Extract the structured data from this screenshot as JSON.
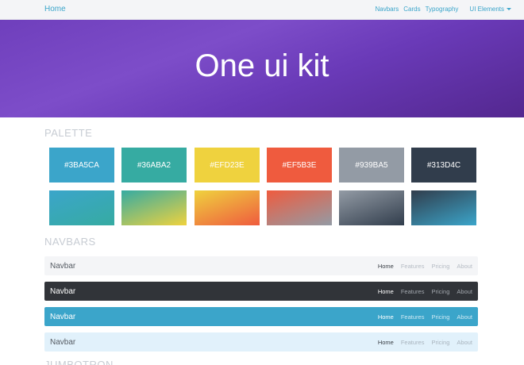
{
  "topnav": {
    "brand": "Home",
    "links": [
      "Navbars",
      "Cards",
      "Typography"
    ],
    "dropdown": "UI Elements"
  },
  "hero": {
    "title": "One ui kit"
  },
  "palette": {
    "heading": "PALETTE",
    "solid": [
      {
        "label": "#3BA5CA",
        "color": "#3BA5CA"
      },
      {
        "label": "#36ABA2",
        "color": "#36ABA2"
      },
      {
        "label": "#EFD23E",
        "color": "#EFD23E"
      },
      {
        "label": "#EF5B3E",
        "color": "#EF5B3E"
      },
      {
        "label": "#939BA5",
        "color": "#939BA5"
      },
      {
        "label": "#313D4C",
        "color": "#313D4C"
      }
    ],
    "gradients": [
      {
        "from": "#3BA5CA",
        "to": "#36ABA2"
      },
      {
        "from": "#36ABA2",
        "to": "#EFD23E"
      },
      {
        "from": "#EFD23E",
        "to": "#EF5B3E"
      },
      {
        "from": "#EF5B3E",
        "to": "#939BA5"
      },
      {
        "from": "#939BA5",
        "to": "#313D4C"
      },
      {
        "from": "#313D4C",
        "to": "#3BA5CA"
      }
    ]
  },
  "navbars": {
    "heading": "NAVBARS",
    "items": [
      {
        "brand": "Navbar",
        "links": [
          "Home",
          "Features",
          "Pricing",
          "About"
        ]
      },
      {
        "brand": "Navbar",
        "links": [
          "Home",
          "Features",
          "Pricing",
          "About"
        ]
      },
      {
        "brand": "Navbar",
        "links": [
          "Home",
          "Features",
          "Pricing",
          "About"
        ]
      },
      {
        "brand": "Navbar",
        "links": [
          "Home",
          "Features",
          "Pricing",
          "About"
        ]
      }
    ]
  },
  "next_section": {
    "heading": "JUMBOTRON"
  }
}
